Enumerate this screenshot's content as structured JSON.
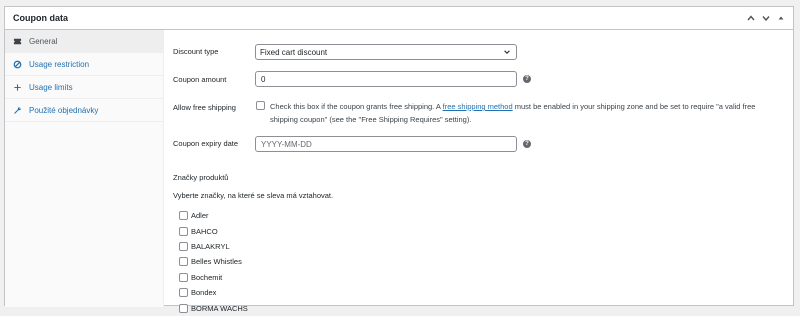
{
  "header": {
    "title": "Coupon data"
  },
  "tabs": [
    {
      "label": "General",
      "icon": "ticket-icon"
    },
    {
      "label": "Usage restriction",
      "icon": "restriction-icon"
    },
    {
      "label": "Usage limits",
      "icon": "plus-icon"
    },
    {
      "label": "Použité objednávky",
      "icon": "wrench-icon"
    }
  ],
  "general": {
    "discount_type": {
      "label": "Discount type",
      "value": "Fixed cart discount"
    },
    "coupon_amount": {
      "label": "Coupon amount",
      "value": "0"
    },
    "free_shipping": {
      "label": "Allow free shipping",
      "text_before": "Check this box if the coupon grants free shipping. A ",
      "link": "free shipping method",
      "text_after": " must be enabled in your shipping zone and be set to require \"a valid free shipping coupon\" (see the \"Free Shipping Requires\" setting)."
    },
    "expiry": {
      "label": "Coupon expiry date",
      "placeholder": "YYYY-MM-DD"
    },
    "help_glyph": "?"
  },
  "brands": {
    "title": "Značky produktů",
    "description": "Vyberte značky, na které se sleva má vztahovat.",
    "items": [
      "Adler",
      "BAHCO",
      "BALAKRYL",
      "Belles Whistles",
      "Bochemit",
      "Bondex",
      "BORMA WACHS"
    ]
  }
}
